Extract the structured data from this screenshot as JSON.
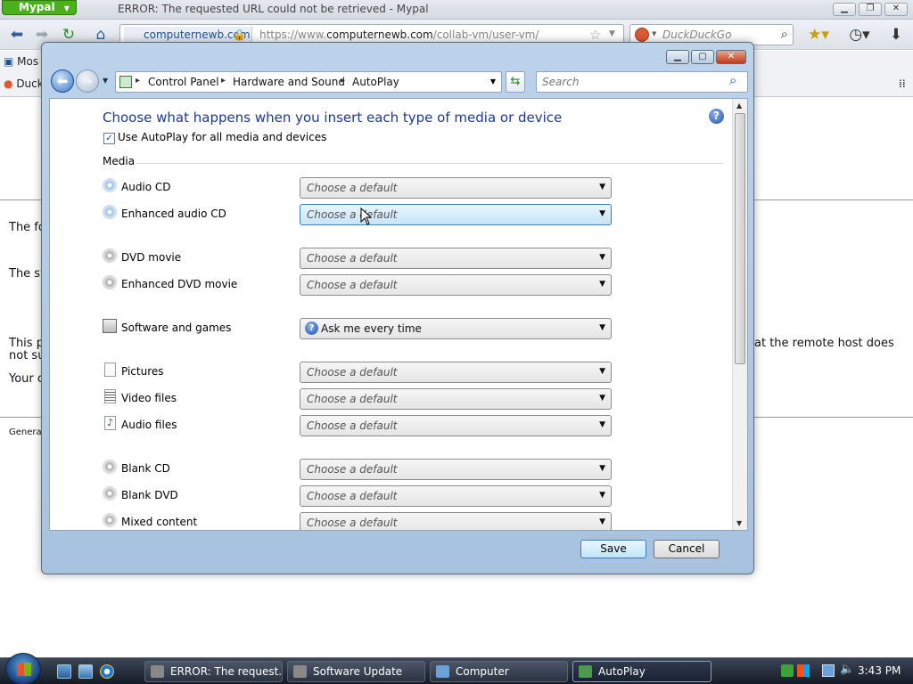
{
  "browser": {
    "app_button": "Mypal",
    "window_title": "ERROR: The requested URL could not be retrieved - Mypal",
    "url_site": "computernewb.com",
    "url_prefix": "https://www.",
    "url_domain": "computernewb.com",
    "url_path": "/collab-vm/user-vm/",
    "search_engine_placeholder": "DuckDuckGo",
    "bookmark_1": "Mos",
    "bookmark_2": "Duck",
    "page_lines": {
      "line1": "The fo",
      "line2": "The sy",
      "line3": "This p",
      "line3_right": "at the remote host does",
      "line3b": "not su",
      "line4": "Your c",
      "footer": "Genera"
    }
  },
  "dialog": {
    "breadcrumb": [
      "Control Panel",
      "Hardware and Sound",
      "AutoPlay"
    ],
    "search_placeholder": "Search",
    "heading": "Choose what happens when you insert each type of media or device",
    "use_autoplay_label": "Use AutoPlay for all media and devices",
    "use_autoplay_checked": true,
    "section_media": "Media",
    "rows": [
      {
        "label": "Audio CD",
        "value": "Choose a default"
      },
      {
        "label": "Enhanced audio CD",
        "value": "Choose a default"
      },
      {
        "label": "DVD movie",
        "value": "Choose a default"
      },
      {
        "label": "Enhanced DVD movie",
        "value": "Choose a default"
      },
      {
        "label": "Software and games",
        "value": "Ask me every time"
      },
      {
        "label": "Pictures",
        "value": "Choose a default"
      },
      {
        "label": "Video files",
        "value": "Choose a default"
      },
      {
        "label": "Audio files",
        "value": "Choose a default"
      },
      {
        "label": "Blank CD",
        "value": "Choose a default"
      },
      {
        "label": "Blank DVD",
        "value": "Choose a default"
      },
      {
        "label": "Mixed content",
        "value": "Choose a default"
      }
    ],
    "save_label": "Save",
    "cancel_label": "Cancel"
  },
  "taskbar": {
    "tasks": [
      "ERROR: The request...",
      "Software Update",
      "Computer",
      "AutoPlay"
    ],
    "clock": "3:43 PM"
  }
}
